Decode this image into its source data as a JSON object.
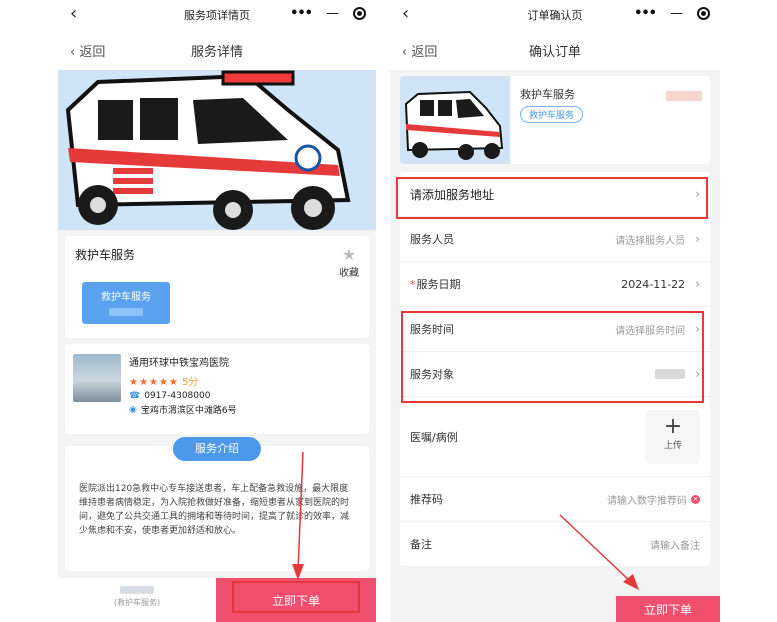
{
  "left": {
    "status_title": "服务项详情页",
    "nav_back": "返回",
    "nav_title": "服务详情",
    "service": {
      "name": "救护车服务",
      "favorite_label": "收藏",
      "button_label": "救护车服务"
    },
    "hospital": {
      "name": "通用环球中铁宝鸡医院",
      "rating_stars": "★★★★★",
      "rating_score": "5分",
      "phone": "0917-4308000",
      "address": "宝鸡市渭滨区中滩路6号"
    },
    "intro": {
      "tag": "服务介绍",
      "text": "医院派出120急救中心专车接送患者，车上配备急救设施，最大限度维持患者病情稳定，为入院抢救做好准备，缩短患者从家到医院的时间，避免了公共交通工具的拥堵和等待时间，提高了就诊的效率，减少焦虑和不安，使患者更加舒适和放心。"
    },
    "bottom": {
      "left_label": "(救护车服务)",
      "submit_label": "立即下单"
    }
  },
  "right": {
    "status_title": "订单确认页",
    "nav_back": "返回",
    "nav_title": "确认订单",
    "product": {
      "name": "救护车服务",
      "tag": "救护车服务"
    },
    "rows": {
      "address": "请添加服务地址",
      "staff_label": "服务人员",
      "staff_placeholder": "请选择服务人员",
      "date_label": "服务日期",
      "date_value": "2024-11-22",
      "time_label": "服务时间",
      "time_placeholder": "请选择服务时间",
      "target_label": "服务对象",
      "medical_label": "医嘱/病例",
      "upload_label": "上传",
      "referral_label": "推荐码",
      "referral_placeholder": "请输入数字推荐码",
      "remark_label": "备注",
      "remark_placeholder": "请输入备注"
    },
    "submit_label": "立即下单"
  },
  "icons": {
    "back": "chevron-left-icon",
    "more": "more-dots-icon",
    "minimize": "minus-icon",
    "record": "record-icon",
    "star": "star-icon",
    "phone": "phone-icon",
    "location": "location-pin-icon",
    "chevron": "chevron-right-icon",
    "plus": "plus-icon",
    "clear": "clear-icon"
  },
  "colors": {
    "accent_blue": "#4c98ec",
    "submit_pink": "#f0506e",
    "highlight_red": "#e53838"
  }
}
